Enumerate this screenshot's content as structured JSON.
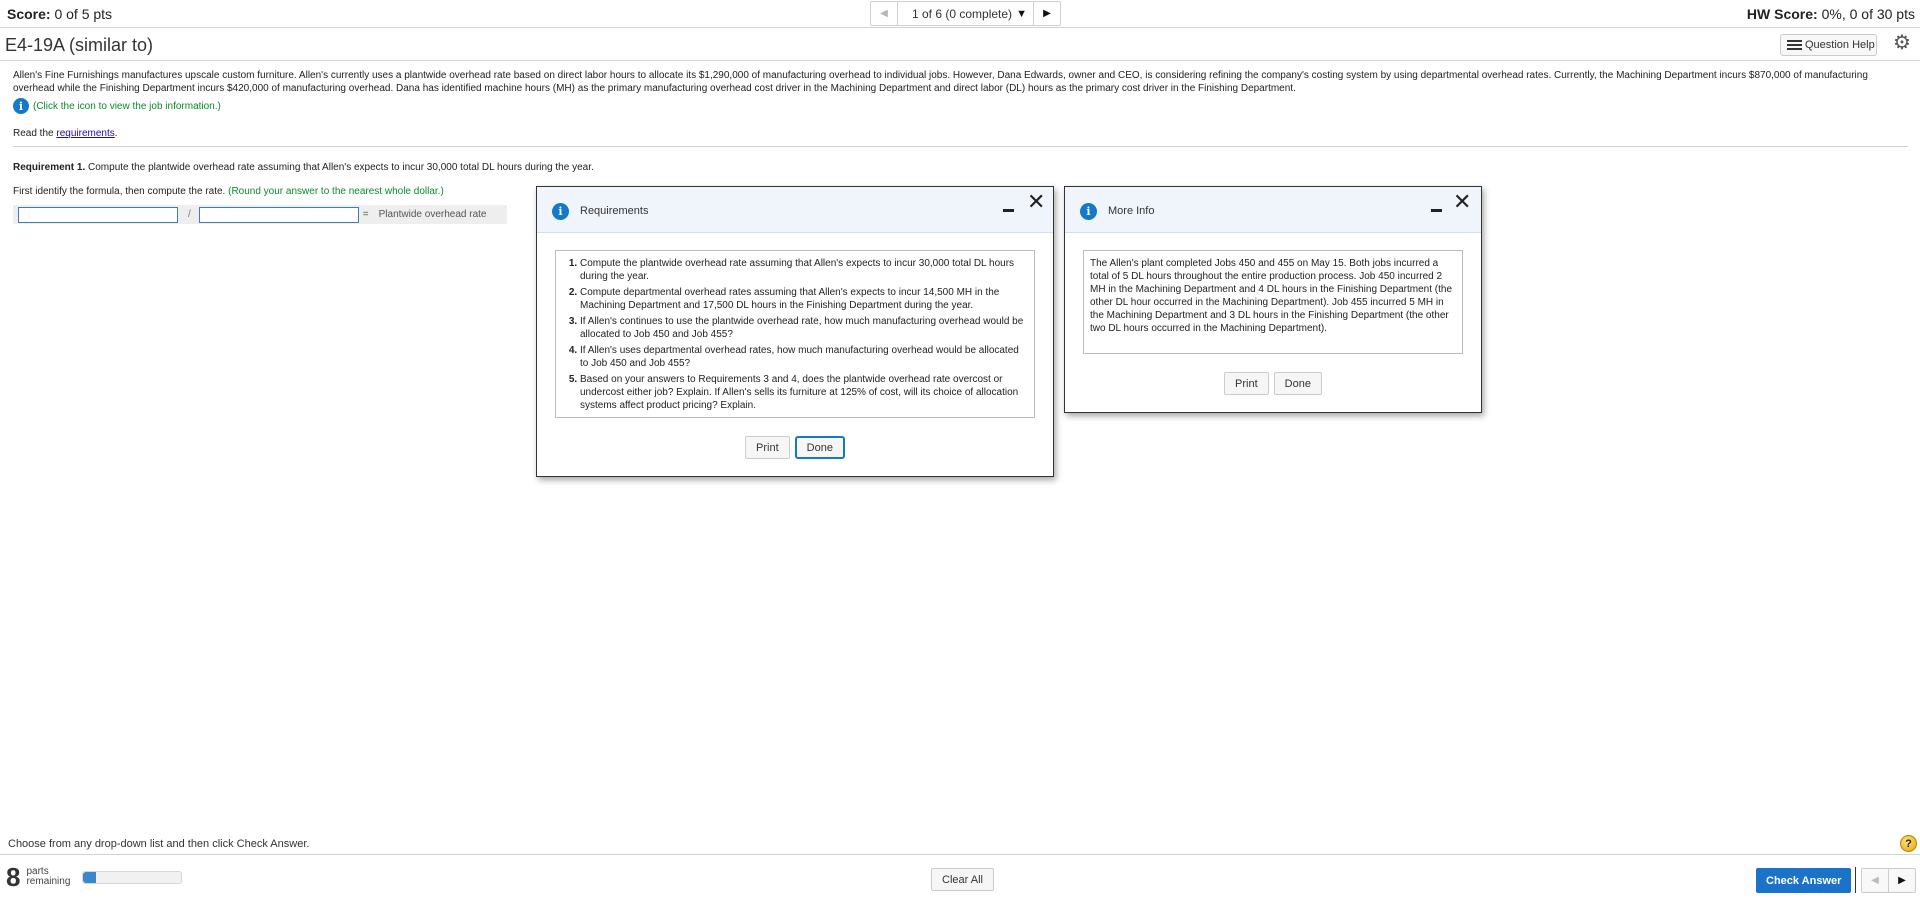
{
  "header": {
    "score_label": "Score:",
    "score_value": "0 of 5 pts",
    "pager_label": "1 of 6 (0 complete)",
    "hw_score_label": "HW Score:",
    "hw_score_value": "0%, 0 of 30 pts"
  },
  "question": {
    "title": "E4-19A (similar to)",
    "help_label": "Question Help",
    "problem_text": "Allen's Fine Furnishings manufactures upscale custom furniture. Allen's currently uses a plantwide overhead rate based on direct labor hours to allocate its $1,290,000 of manufacturing overhead to individual jobs. However, Dana Edwards, owner and CEO, is considering refining the company's costing system by using departmental overhead rates. Currently, the Machining Department incurs $870,000 of manufacturing overhead while the Finishing Department incurs $420,000 of manufacturing overhead. Dana has identified machine hours (MH) as the primary manufacturing overhead cost driver in the Machining Department and direct labor (DL) hours as the primary cost driver in the Finishing Department.",
    "info_link_text": "(Click the icon to view the job information.)",
    "read_prefix": "Read the ",
    "read_link": "requirements",
    "read_suffix": ".",
    "req1_label": "Requirement 1.",
    "req1_text": " Compute the plantwide overhead rate assuming that Allen's expects to incur 30,000 total DL hours during the year.",
    "first_identify": "First identify the formula, then compute the rate. ",
    "round_note": "(Round your answer to the nearest whole dollar.)",
    "formula": {
      "numerator_value": "",
      "denominator_value": "",
      "slash": "/",
      "equals": "=",
      "result_label": "Plantwide overhead rate"
    }
  },
  "requirements_dialog": {
    "title": "Requirements",
    "items": [
      "Compute the plantwide overhead rate assuming that Allen's expects to incur 30,000 total DL hours during the year.",
      "Compute departmental overhead rates assuming that Allen's expects to incur 14,500 MH in the Machining Department and 17,500 DL hours in the Finishing Department during the year.",
      "If Allen's continues to use the plantwide overhead rate, how much manufacturing overhead would be allocated to Job 450 and Job 455?",
      "If Allen's uses departmental overhead rates, how much manufacturing overhead would be allocated to Job 450 and Job 455?",
      "Based on your answers to Requirements 3 and 4, does the plantwide overhead rate overcost or undercost either job? Explain. If Allen's sells its furniture at 125% of cost, will its choice of allocation systems affect product pricing? Explain."
    ],
    "print_label": "Print",
    "done_label": "Done"
  },
  "moreinfo_dialog": {
    "title": "More Info",
    "text": "The Allen's plant completed Jobs 450 and 455 on May 15. Both jobs incurred a total of 5 DL hours throughout the entire production process. Job 450 incurred 2 MH in the Machining Department and 4 DL hours in the Finishing Department (the other DL hour occurred in the Machining Department). Job 455 incurred 5 MH in the Machining Department and 3 DL hours in the Finishing Department (the other two DL hours occurred in the Machining Department).",
    "print_label": "Print",
    "done_label": "Done"
  },
  "footer": {
    "instruction": "Choose from any drop-down list and then click Check Answer.",
    "parts_count": "8",
    "parts_label_1": "parts",
    "parts_label_2": "remaining",
    "progress_fraction": 0.125,
    "clear_all_label": "Clear All",
    "check_answer_label": "Check Answer",
    "help_glyph": "?"
  },
  "icons": {
    "prev": "◀",
    "next": "▶",
    "caret": "▼",
    "gear": "⚙",
    "info": "i",
    "close": "✕"
  },
  "colors": {
    "accent": "#1a73c8",
    "info_green": "#0b8a2b",
    "link": "#1a0dab"
  }
}
